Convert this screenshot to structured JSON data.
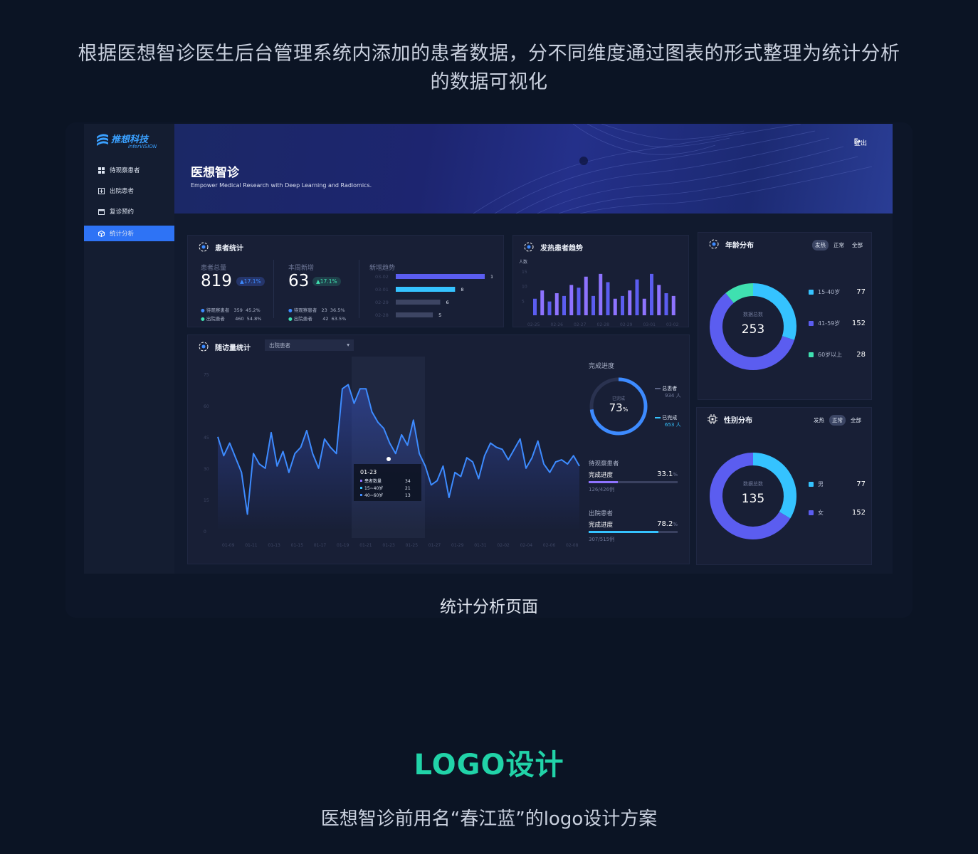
{
  "intro": "根据医想智诊医生后台管理系统内添加的患者数据，分不同维度通过图表的形式整理为统计分析的数据可视化",
  "logo": {
    "cn": "推想科技",
    "en": "inferVISION"
  },
  "sidebar": {
    "items": [
      {
        "label": "待观察患者"
      },
      {
        "label": "出院患者"
      },
      {
        "label": "复诊预约"
      },
      {
        "label": "统计分析",
        "active": true
      }
    ]
  },
  "banner": {
    "title": "医想智诊",
    "subtitle": "Empower Medical Research with Deep Learning and Radiomics.",
    "logout": "登出"
  },
  "patient_stats": {
    "title": "患者统计",
    "total": {
      "label": "患者总量",
      "value": "819",
      "change": "17.1%",
      "rows": [
        {
          "label": "待观察患者",
          "count": "359",
          "pct": "45.2%"
        },
        {
          "label": "出院患者",
          "count": "460",
          "pct": "54.8%"
        }
      ]
    },
    "weekly": {
      "label": "本周新增",
      "value": "63",
      "change": "17.1%",
      "rows": [
        {
          "label": "待观察患者",
          "count": "23",
          "pct": "36.5%"
        },
        {
          "label": "出院患者",
          "count": "42",
          "pct": "63.5%"
        }
      ]
    },
    "trend": {
      "label": "新增趋势"
    }
  },
  "colors": {
    "blue": "#3d8bff",
    "cyan": "#35c3ff",
    "purple": "#8e73ff",
    "indigo": "#5b5df0",
    "teal": "#3fe0b0",
    "gray": "#3d4563"
  },
  "chart_data": [
    {
      "type": "bar",
      "title": "新增趋势",
      "orientation": "horizontal",
      "categories": [
        "03-02",
        "03-01",
        "02-29",
        "02-28"
      ],
      "values": [
        12,
        8,
        6,
        5
      ]
    },
    {
      "type": "bar",
      "title": "发热患者趋势",
      "ylabel": "人数",
      "yticks": [
        15,
        10,
        5
      ],
      "categories": [
        "02-25",
        "02-26",
        "02-27",
        "02-28",
        "02-29",
        "03-01",
        "03-02"
      ],
      "values": [
        6,
        9,
        5,
        8,
        7,
        11,
        10,
        14,
        7,
        15,
        12,
        6,
        7,
        9,
        13,
        6,
        15,
        11,
        8,
        7
      ]
    },
    {
      "type": "line",
      "title": "随访量统计",
      "yticks": [
        75,
        60,
        45,
        30,
        15,
        0
      ],
      "ylim": [
        0,
        80
      ],
      "x_ticks": [
        "01-09",
        "01-11",
        "01-13",
        "01-15",
        "01-17",
        "01-19",
        "01-21",
        "01-23",
        "01-25",
        "01-27",
        "01-29",
        "01-31",
        "02-02",
        "02-04",
        "02-06",
        "02-08"
      ],
      "values": [
        45,
        36,
        42,
        35,
        28,
        8,
        37,
        32,
        30,
        47,
        31,
        38,
        28,
        37,
        40,
        48,
        37,
        30,
        44,
        40,
        37,
        68,
        70,
        61,
        68,
        68,
        57,
        52,
        49,
        42,
        37,
        46,
        41,
        53,
        37,
        31,
        22,
        24,
        31,
        16,
        28,
        26,
        35,
        33,
        25,
        36,
        42,
        40,
        39,
        34,
        39,
        44,
        30,
        35,
        43,
        32,
        28,
        33,
        34,
        32,
        36,
        31
      ],
      "tooltip": {
        "date": "01-23",
        "rows": [
          {
            "label": "患者数量",
            "value": "34"
          },
          {
            "label": "15~40岁",
            "value": "21"
          },
          {
            "label": "40~60岁",
            "value": "13"
          }
        ]
      }
    },
    {
      "type": "pie",
      "title": "年龄分布",
      "total": "253",
      "slices": [
        {
          "label": "15-40岁",
          "value": 77
        },
        {
          "label": "41-59岁",
          "value": 152
        },
        {
          "label": "60岁以上",
          "value": 28
        }
      ]
    },
    {
      "type": "pie",
      "title": "性别分布",
      "total": "135",
      "slices": [
        {
          "label": "男",
          "value": 77
        },
        {
          "label": "女",
          "value": 152
        }
      ]
    }
  ],
  "followup": {
    "title": "随访量统计",
    "select": "出院患者",
    "progress_title": "完成进度",
    "ring_label": "已完成",
    "ring_value": "73",
    "ring_unit": "%",
    "legend": [
      {
        "label": "总患者",
        "value": "934"
      },
      {
        "label": "已完成",
        "value": "653"
      }
    ],
    "observing": {
      "title": "待观察患者",
      "label": "完成进度",
      "value": "33.1",
      "sub": "126/426例",
      "fraction": 0.331
    },
    "discharged": {
      "title": "出院患者",
      "label": "完成进度",
      "value": "78.2",
      "sub": "307/515例",
      "fraction": 0.782
    }
  },
  "fever": {
    "title": "发热患者趋势",
    "ylabel": "人数"
  },
  "age": {
    "title": "年龄分布",
    "center_label": "数据总数",
    "filters": [
      "发热",
      "正常",
      "全部"
    ],
    "active": "发热"
  },
  "gender": {
    "title": "性别分布",
    "center_label": "数据总数",
    "filters": [
      "发热",
      "正常",
      "全部"
    ],
    "active": "正常"
  },
  "caption": "统计分析页面",
  "logo_section": {
    "title": "LOGO设计",
    "subtitle": "医想智诊前用名“春江蓝”的logo设计方案"
  }
}
